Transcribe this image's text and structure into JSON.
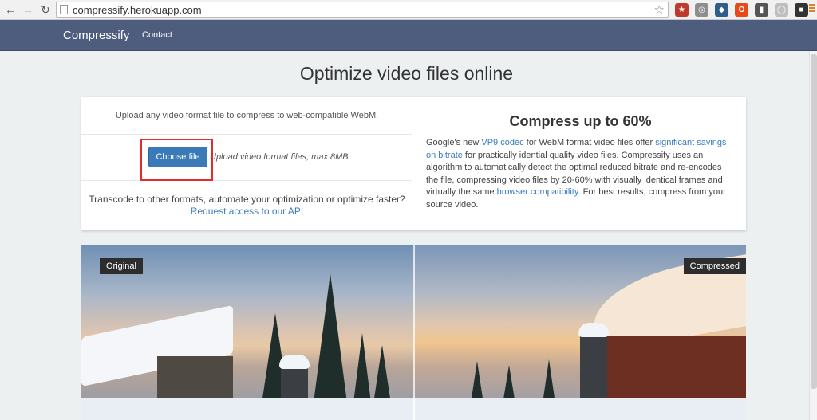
{
  "browser": {
    "url": "compressify.herokuapp.com",
    "extensions": [
      {
        "icon": "ext-icon-1",
        "color": "#c0392b",
        "glyph": "★"
      },
      {
        "icon": "ext-icon-2",
        "color": "#8e8e8e",
        "glyph": "◎"
      },
      {
        "icon": "ext-icon-3",
        "color": "#2c5f8a",
        "glyph": "◆"
      },
      {
        "icon": "office-icon",
        "color": "#e64a19",
        "glyph": "O"
      },
      {
        "icon": "bookmark-icon",
        "color": "#555555",
        "glyph": "▮"
      },
      {
        "icon": "ext-icon-6",
        "color": "#bfbfbf",
        "glyph": "◯"
      },
      {
        "icon": "ext-icon-7",
        "color": "#333333",
        "glyph": "■"
      }
    ]
  },
  "nav": {
    "brand": "Compressify",
    "links": [
      "Contact"
    ]
  },
  "page": {
    "title": "Optimize video files online"
  },
  "upload": {
    "intro": "Upload any video format file to compress to web-compatible WebM.",
    "button_label": "Choose file",
    "hint": "Upload video format files, max 8MB",
    "api_text": "Transcode to other formats, automate your optimization or optimize faster?",
    "api_link": "Request access to our API"
  },
  "info": {
    "heading": "Compress up to 60%",
    "p1": "Google's new ",
    "link1": "VP9 codec",
    "p2": " for WebM format video files offer ",
    "link2": "significant savings on bitrate",
    "p3": " for practically idential quality video files. Compressify uses an algorithm to automatically detect the optimal reduced bitrate and re-encodes the file, compressing video files by 20-60% with visually identical frames and virtually the same ",
    "link3": "browser compatibility",
    "p4": ". For best results, compress from your source video."
  },
  "comparison": {
    "left_label": "Original",
    "right_label": "Compressed"
  },
  "colors": {
    "navbar": "#4e5d7e",
    "link": "#3b7dbf",
    "button": "#3a7ab8",
    "highlight": "#e32b2b"
  }
}
